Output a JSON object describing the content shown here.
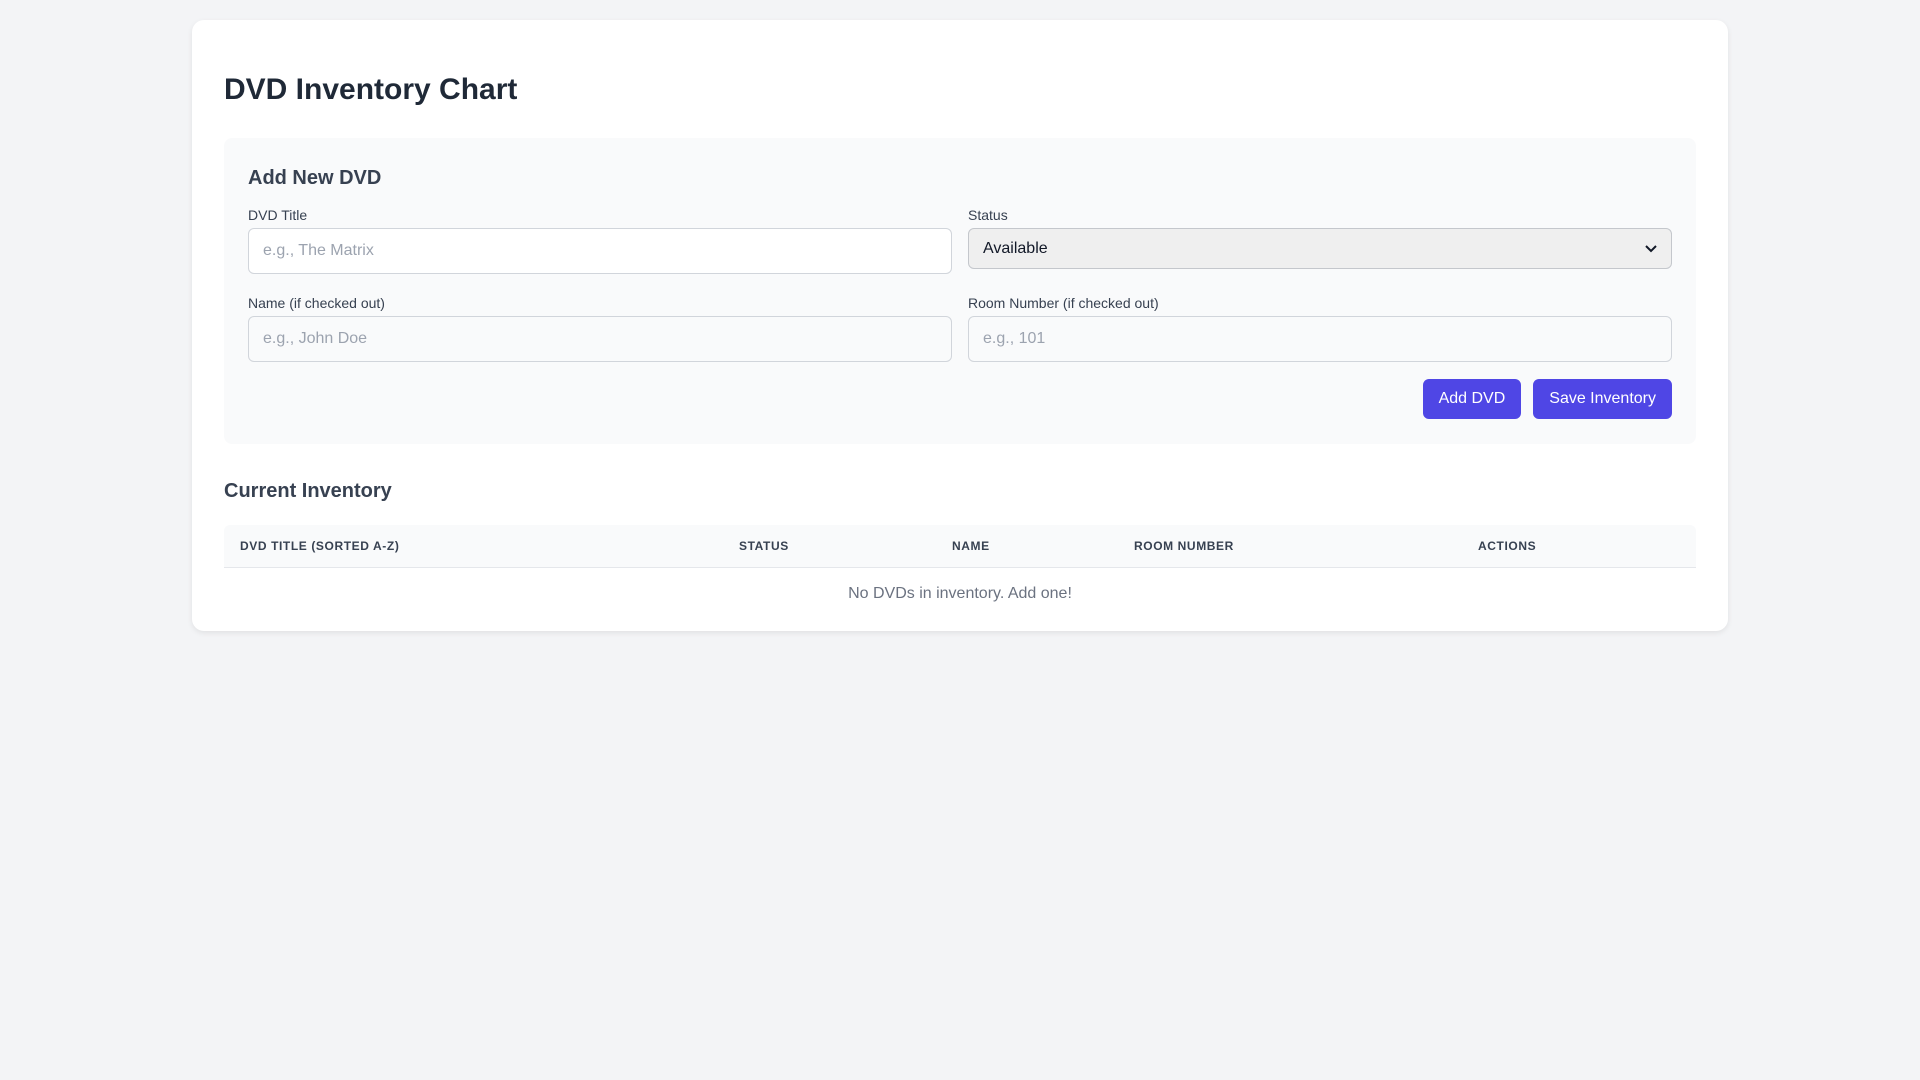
{
  "page": {
    "title": "DVD Inventory Chart"
  },
  "form": {
    "heading": "Add New DVD",
    "dvd_title": {
      "label": "DVD Title",
      "placeholder": "e.g., The Matrix",
      "value": ""
    },
    "status": {
      "label": "Status",
      "selected": "Available"
    },
    "name": {
      "label": "Name (if checked out)",
      "placeholder": "e.g., John Doe",
      "value": ""
    },
    "room_number": {
      "label": "Room Number (if checked out)",
      "placeholder": "e.g., 101",
      "value": ""
    },
    "add_button": "Add DVD",
    "save_button": "Save Inventory"
  },
  "inventory": {
    "heading": "Current Inventory",
    "columns": [
      "DVD Title (Sorted A-Z)",
      "Status",
      "Name",
      "Room Number",
      "Actions"
    ],
    "empty_message": "No DVDs in inventory. Add one!"
  },
  "icons": {
    "status_select": "chevron-down-icon"
  },
  "colors": {
    "accent": "#4f46e5",
    "background": "#f3f4f6",
    "panel": "#f9fafb"
  }
}
